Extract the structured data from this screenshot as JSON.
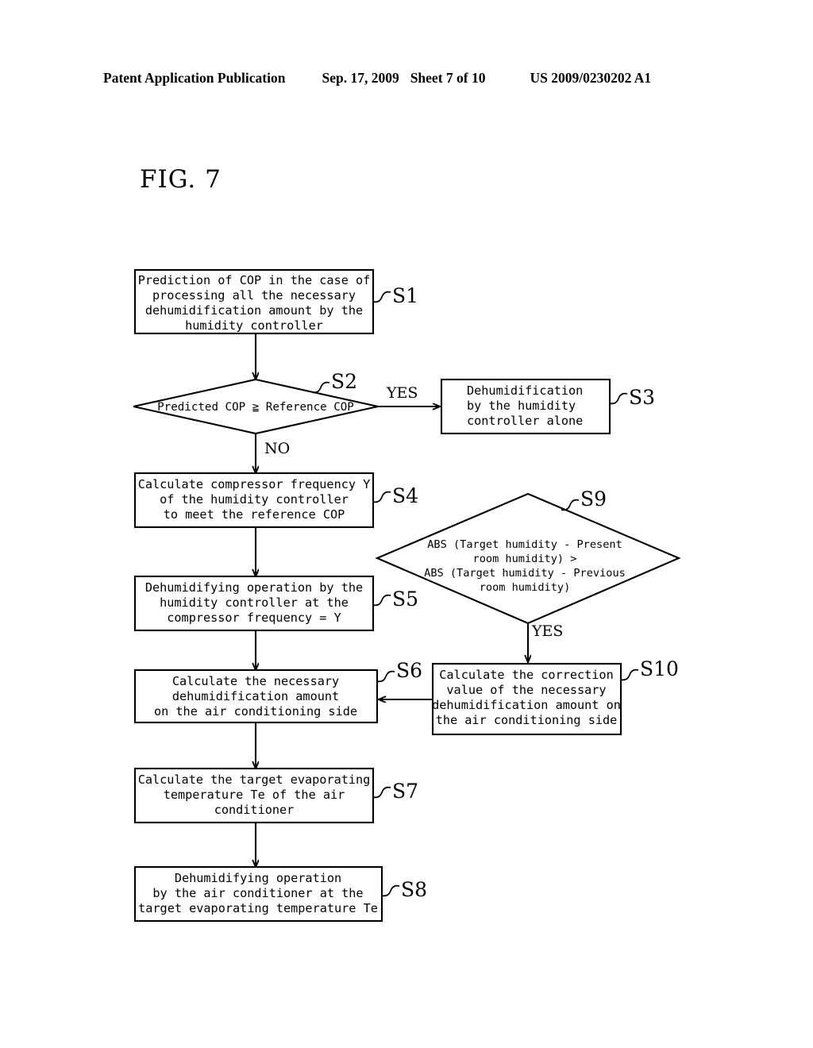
{
  "header": {
    "publication": "Patent Application Publication",
    "date": "Sep. 17, 2009",
    "sheet": "Sheet 7 of 10",
    "patent_number": "US 2009/0230202 A1"
  },
  "figure": {
    "label": "FIG. 7"
  },
  "flowchart": {
    "title": "FIG. 7",
    "type": "flowchart",
    "nodes": [
      {
        "id": "S1",
        "step": "S1",
        "shape": "process",
        "lines": [
          "Prediction of COP in the case of",
          "processing all the necessary",
          "dehumidification amount by the",
          "humidity controller"
        ]
      },
      {
        "id": "S2",
        "step": "S2",
        "shape": "decision",
        "lines": [
          "Predicted COP ≧ Reference COP"
        ]
      },
      {
        "id": "S3",
        "step": "S3",
        "shape": "process",
        "lines": [
          "Dehumidification",
          "by the humidity",
          "controller alone"
        ]
      },
      {
        "id": "S4",
        "step": "S4",
        "shape": "process",
        "lines": [
          "Calculate compressor frequency Y",
          "of the humidity controller",
          "to meet the reference COP"
        ]
      },
      {
        "id": "S5",
        "step": "S5",
        "shape": "process",
        "lines": [
          "Dehumidifying operation by the",
          "humidity controller at the",
          "compressor frequency = Y"
        ]
      },
      {
        "id": "S6",
        "step": "S6",
        "shape": "process",
        "lines": [
          "Calculate the necessary",
          "dehumidification amount",
          "on the air conditioning side"
        ]
      },
      {
        "id": "S7",
        "step": "S7",
        "shape": "process",
        "lines": [
          "Calculate the target evaporating",
          "temperature Te of the air",
          "conditioner"
        ]
      },
      {
        "id": "S8",
        "step": "S8",
        "shape": "process",
        "lines": [
          "Dehumidifying operation",
          "by the air conditioner at the",
          "target evaporating temperature Te"
        ]
      },
      {
        "id": "S9",
        "step": "S9",
        "shape": "decision",
        "lines": [
          "ABS (Target humidity - Present",
          "room humidity) >",
          "ABS (Target humidity - Previous",
          "room humidity)"
        ]
      },
      {
        "id": "S10",
        "step": "S10",
        "shape": "process",
        "lines": [
          "Calculate the correction",
          "value of the necessary",
          "dehumidification amount on",
          "the air conditioning side"
        ]
      }
    ],
    "branch_labels": {
      "s2_yes": "YES",
      "s2_no": "NO",
      "s9_yes": "YES"
    },
    "edges": [
      {
        "from": "S1",
        "to": "S2",
        "label": ""
      },
      {
        "from": "S2",
        "to": "S3",
        "label": "YES"
      },
      {
        "from": "S2",
        "to": "S4",
        "label": "NO"
      },
      {
        "from": "S4",
        "to": "S5",
        "label": ""
      },
      {
        "from": "S5",
        "to": "S6",
        "label": ""
      },
      {
        "from": "S6",
        "to": "S7",
        "label": ""
      },
      {
        "from": "S7",
        "to": "S8",
        "label": ""
      },
      {
        "from": "S9",
        "to": "S10",
        "label": "YES"
      },
      {
        "from": "S10",
        "to": "S6",
        "label": ""
      }
    ]
  }
}
